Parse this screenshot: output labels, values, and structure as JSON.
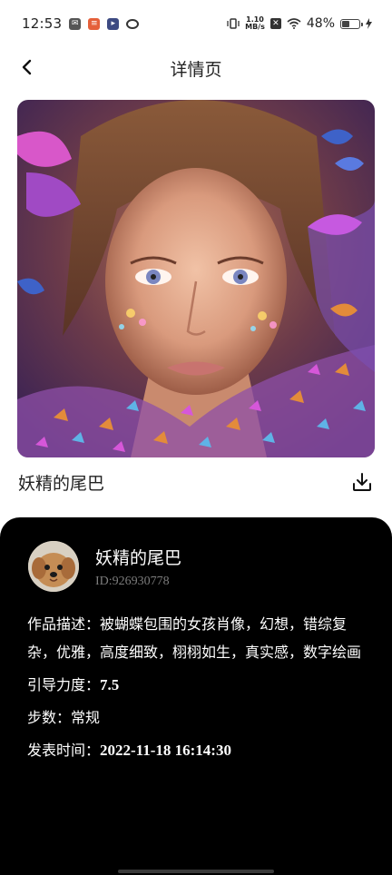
{
  "status_bar": {
    "time": "12:53",
    "notification_icons": [
      "mail-icon",
      "app-orange-icon",
      "app-blue-icon",
      "link-icon"
    ],
    "net_speed_value": "1.10",
    "net_speed_unit": "MB/s",
    "battery_percent": "48%",
    "battery_level": 0.48
  },
  "header": {
    "title": "详情页",
    "back_icon": "chevron-left-icon"
  },
  "artwork": {
    "title": "妖精的尾巴",
    "download_icon": "download-icon"
  },
  "author": {
    "name": "妖精的尾巴",
    "id": "ID:926930778"
  },
  "details": {
    "description_label": "作品描述：",
    "description_value": "被蝴蝶包围的女孩肖像，幻想，错综复杂，优雅，高度细致，栩栩如生，真实感，数字绘画",
    "guidance_label": "引导力度：",
    "guidance_value": "7.5",
    "steps_label": "步数：",
    "steps_value": "常规",
    "published_label": "发表时间：",
    "published_value": "2022-11-18 16:14:30"
  },
  "colors": {
    "card_background": "#000000",
    "page_background": "#ffffff",
    "muted_text": "#7d7d7d"
  }
}
